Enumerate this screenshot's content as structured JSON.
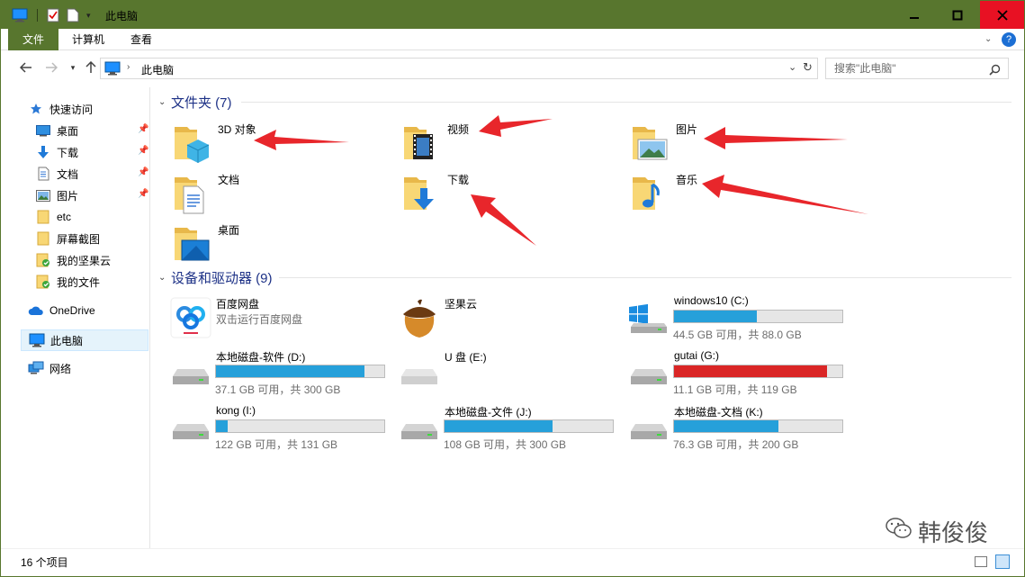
{
  "window": {
    "title": "此电脑",
    "accent": "#58762e"
  },
  "ribbon": {
    "tabs": [
      "文件",
      "计算机",
      "查看"
    ]
  },
  "address": {
    "path": "此电脑",
    "search_placeholder": "搜索\"此电脑\""
  },
  "sidebar": {
    "items": [
      {
        "label": "快速访问",
        "icon": "star-icon"
      },
      {
        "label": "桌面",
        "icon": "desktop-icon",
        "pinned": true
      },
      {
        "label": "下载",
        "icon": "download-icon",
        "pinned": true
      },
      {
        "label": "文档",
        "icon": "document-icon",
        "pinned": true
      },
      {
        "label": "图片",
        "icon": "picture-icon",
        "pinned": true
      },
      {
        "label": "etc",
        "icon": "folder-icon"
      },
      {
        "label": "屏幕截图",
        "icon": "folder-icon"
      },
      {
        "label": "我的坚果云",
        "icon": "sync-folder-icon"
      },
      {
        "label": "我的文件",
        "icon": "sync-folder-icon"
      },
      {
        "label": "OneDrive",
        "icon": "cloud-icon"
      },
      {
        "label": "此电脑",
        "icon": "computer-icon",
        "selected": true
      },
      {
        "label": "网络",
        "icon": "network-icon"
      }
    ]
  },
  "folders": {
    "header": "文件夹 (7)",
    "items": [
      {
        "name": "3D 对象"
      },
      {
        "name": "视频"
      },
      {
        "name": "图片"
      },
      {
        "name": "文档"
      },
      {
        "name": "下载"
      },
      {
        "name": "音乐"
      },
      {
        "name": "桌面"
      }
    ]
  },
  "devices": {
    "header": "设备和驱动器 (9)",
    "apps": [
      {
        "name": "百度网盘",
        "sub": "双击运行百度网盘"
      },
      {
        "name": "坚果云",
        "sub": ""
      }
    ],
    "drives": [
      {
        "name": "windows10 (C:)",
        "free": "44.5 GB 可用，共 88.0 GB",
        "used_fraction": 0.49,
        "color": "#26a0da"
      },
      {
        "name": "本地磁盘-软件 (D:)",
        "free": "37.1 GB 可用，共 300 GB",
        "used_fraction": 0.88,
        "color": "#26a0da"
      },
      {
        "name": "U 盘 (E:)",
        "free": "",
        "used_fraction": null,
        "color": "#26a0da"
      },
      {
        "name": "gutai (G:)",
        "free": "11.1 GB 可用，共 119 GB",
        "used_fraction": 0.91,
        "color": "#da2626"
      },
      {
        "name": "kong (I:)",
        "free": "122 GB 可用，共 131 GB",
        "used_fraction": 0.07,
        "color": "#26a0da"
      },
      {
        "name": "本地磁盘-文件 (J:)",
        "free": "108 GB 可用，共 300 GB",
        "used_fraction": 0.64,
        "color": "#26a0da"
      },
      {
        "name": "本地磁盘-文档 (K:)",
        "free": "76.3 GB 可用，共 200 GB",
        "used_fraction": 0.62,
        "color": "#26a0da"
      }
    ]
  },
  "status": {
    "count": "16 个项目"
  },
  "watermark": "韩俊俊"
}
